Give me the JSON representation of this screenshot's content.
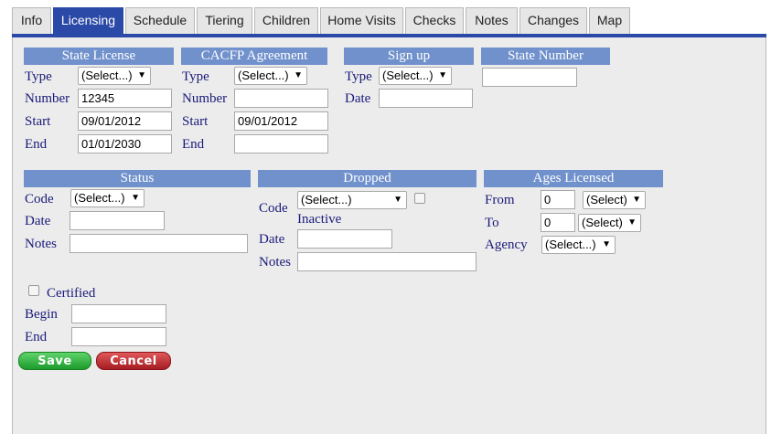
{
  "tabs": [
    "Info",
    "Licensing",
    "Schedule",
    "Tiering",
    "Children",
    "Home Visits",
    "Checks",
    "Notes",
    "Changes",
    "Map"
  ],
  "state_license": {
    "header": "State License",
    "type_label": "Type",
    "type_value": "(Select...)",
    "number_label": "Number",
    "number_value": "12345",
    "start_label": "Start",
    "start_value": "09/01/2012",
    "end_label": "End",
    "end_value": "01/01/2030"
  },
  "cacfp": {
    "header": "CACFP Agreement",
    "type_label": "Type",
    "type_value": "(Select...)",
    "number_label": "Number",
    "number_value": "",
    "start_label": "Start",
    "start_value": "09/01/2012",
    "end_label": "End",
    "end_value": ""
  },
  "signup": {
    "header": "Sign up",
    "type_label": "Type",
    "type_value": "(Select...)",
    "date_label": "Date",
    "date_value": ""
  },
  "state_number": {
    "header": "State Number",
    "value": ""
  },
  "status": {
    "header": "Status",
    "code_label": "Code",
    "code_value": "(Select...)",
    "date_label": "Date",
    "date_value": "",
    "notes_label": "Notes",
    "notes_value": ""
  },
  "dropped": {
    "header": "Dropped",
    "code_label": "Code",
    "code_value": "(Select...)",
    "inactive_label": "Inactive",
    "date_label": "Date",
    "date_value": "",
    "notes_label": "Notes",
    "notes_value": ""
  },
  "ages": {
    "header": "Ages Licensed",
    "from_label": "From",
    "from_value": "0",
    "from_unit": "(Select)",
    "to_label": "To",
    "to_value": "0",
    "to_unit": "(Select)",
    "agency_label": "Agency",
    "agency_value": "(Select...)"
  },
  "certified": {
    "label": "Certified",
    "begin_label": "Begin",
    "begin_value": "",
    "end_label": "End",
    "end_value": ""
  },
  "buttons": {
    "save": "Save",
    "cancel": "Cancel"
  },
  "colors": {
    "tab_active": "#2b4aa7",
    "header_bg": "#7091cc",
    "label_text": "#1a1a7a",
    "panel_bg": "#ececec"
  }
}
